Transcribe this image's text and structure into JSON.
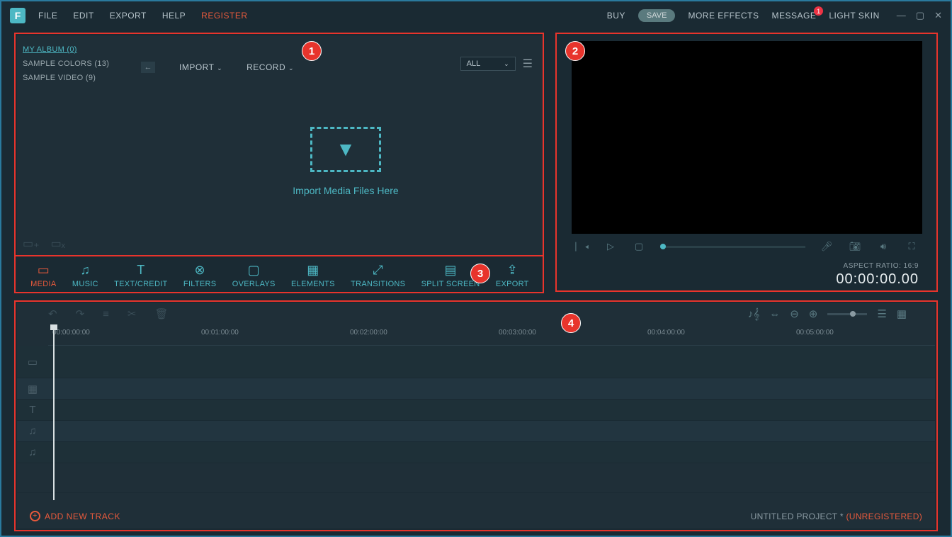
{
  "logo": "F",
  "menu": [
    "FILE",
    "EDIT",
    "EXPORT",
    "HELP",
    "REGISTER"
  ],
  "top_right": {
    "buy": "BUY",
    "save": "SAVE",
    "more_effects": "MORE EFFECTS",
    "message": "MESSAGE",
    "badge": "1",
    "light_skin": "LIGHT SKIN"
  },
  "library": {
    "side": [
      {
        "label": "MY ALBUM (0)",
        "active": true
      },
      {
        "label": "SAMPLE COLORS (13)",
        "active": false
      },
      {
        "label": "SAMPLE VIDEO (9)",
        "active": false
      }
    ],
    "import": "IMPORT",
    "record": "RECORD",
    "filter": "ALL",
    "dropzone": "Import Media Files Here"
  },
  "preview": {
    "aspect": "ASPECT RATIO: 16:9",
    "timecode": "00:00:00.00"
  },
  "tabs": [
    {
      "label": "MEDIA",
      "icon": "▭",
      "active": true
    },
    {
      "label": "MUSIC",
      "icon": "♫",
      "active": false
    },
    {
      "label": "TEXT/CREDIT",
      "icon": "T",
      "active": false
    },
    {
      "label": "FILTERS",
      "icon": "⊗",
      "active": false
    },
    {
      "label": "OVERLAYS",
      "icon": "▢",
      "active": false
    },
    {
      "label": "ELEMENTS",
      "icon": "▦",
      "active": false
    },
    {
      "label": "TRANSITIONS",
      "icon": "⤢",
      "active": false
    },
    {
      "label": "SPLIT SCREEN",
      "icon": "▤",
      "active": false
    },
    {
      "label": "EXPORT",
      "icon": "⇪",
      "active": false
    }
  ],
  "timeline": {
    "ticks": [
      "00:00:00:00",
      "00:01:00:00",
      "00:02:00:00",
      "00:03:00:00",
      "00:04:00:00",
      "00:05:00:00"
    ],
    "add_track": "ADD NEW TRACK",
    "project": "UNTITLED PROJECT * ",
    "unregistered": "(UNREGISTERED)"
  },
  "annotations": [
    "1",
    "2",
    "3",
    "4"
  ]
}
